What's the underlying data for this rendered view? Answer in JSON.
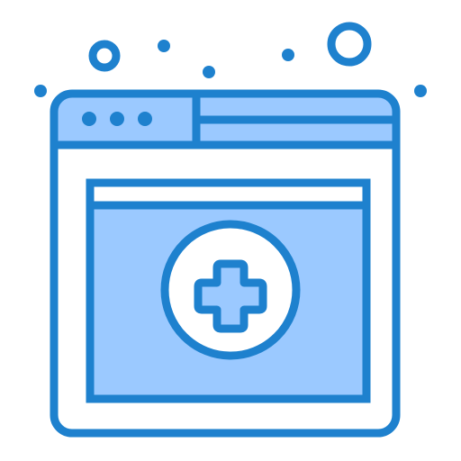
{
  "icon": {
    "name": "medical-browser-window-icon",
    "colors": {
      "stroke": "#1e81ce",
      "fill_light": "#9bc9ff",
      "background": "#ffffff"
    }
  },
  "decorations": {
    "bubbles": [
      "small-circle-outline",
      "large-circle-outline",
      "dots"
    ]
  }
}
